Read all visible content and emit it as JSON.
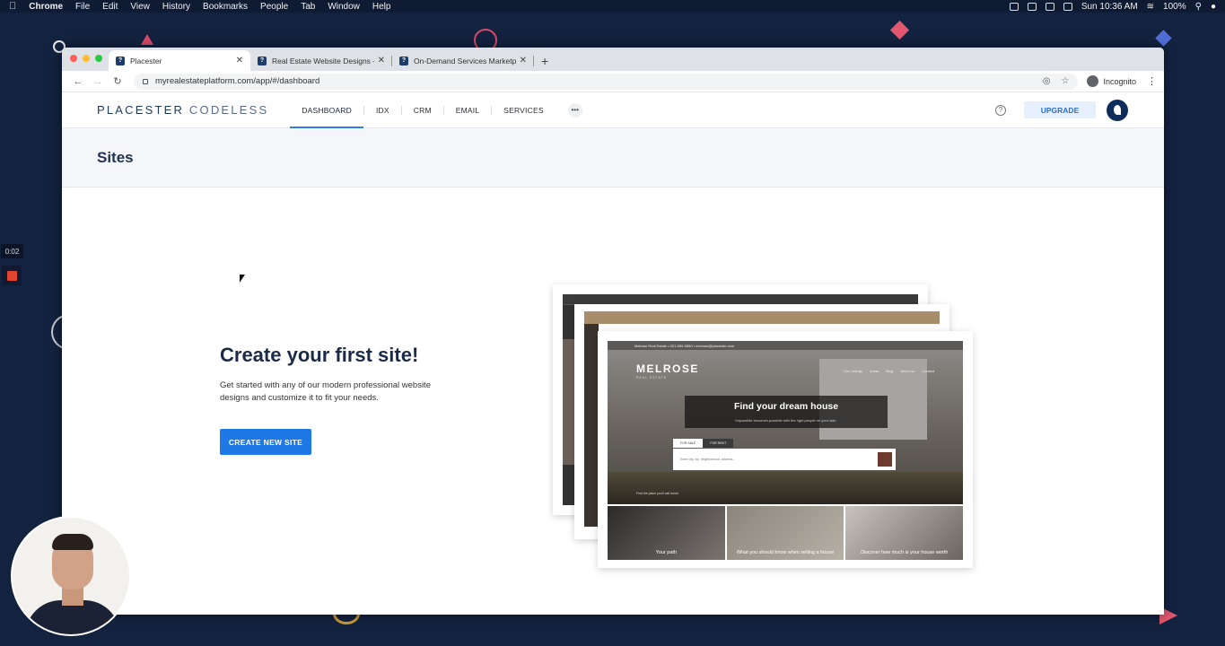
{
  "menubar": {
    "apple": "",
    "app_name": "Chrome",
    "items": [
      "File",
      "Edit",
      "View",
      "History",
      "Bookmarks",
      "People",
      "Tab",
      "Window",
      "Help"
    ],
    "battery": "100%",
    "clock": "Sun 10:36 AM"
  },
  "recording": {
    "timer": "0:02"
  },
  "browser": {
    "tabs": [
      {
        "title": "Placester",
        "active": true
      },
      {
        "title": "Real Estate Website Designs –",
        "active": false
      },
      {
        "title": "On-Demand Services Marketpl",
        "active": false
      }
    ],
    "new_tab": "+",
    "url": "myrealestateplatform.com/app/#/dashboard",
    "profile_label": "Incognito"
  },
  "app": {
    "logo_main": "PLACESTER",
    "logo_sub": "CODELESS",
    "nav": [
      "DASHBOARD",
      "IDX",
      "CRM",
      "EMAIL",
      "SERVICES"
    ],
    "more": "•••",
    "help": "?",
    "upgrade_label": "UPGRADE",
    "page_title": "Sites",
    "cta": {
      "title": "Create your first site!",
      "subtitle": "Get started with any of our modern professional website designs and customize it to fit your needs.",
      "button": "CREATE NEW SITE"
    }
  },
  "preview": {
    "brand": "MELROSE",
    "brand_sub": "REAL ESTATE",
    "menu": [
      "Our Listings",
      "Areas",
      "Blog",
      "About us",
      "Contact"
    ],
    "topline": "Melrose Real Estate   •   021-599-9850   •   melrose@placester.com",
    "hero_title": "Find your dream house",
    "hero_sub": "Impossible becomes possible with the right people on your side.",
    "search_tabs": [
      "FOR SALE",
      "FOR RENT"
    ],
    "search_placeholder": "Enter city, zip, neighborhood, address...",
    "hero_footer": "Find the place you'll call home",
    "tiles": [
      "Your path",
      "What you should know when selling a house",
      "Discover how much is your house worth"
    ]
  },
  "colors": {
    "desktop_bg": "#13223f",
    "primary_button": "#1e78e6",
    "upgrade_bg": "#e6f0fc",
    "logo": "#1e3a5f",
    "active_tab_underline": "#2f7ce6"
  }
}
